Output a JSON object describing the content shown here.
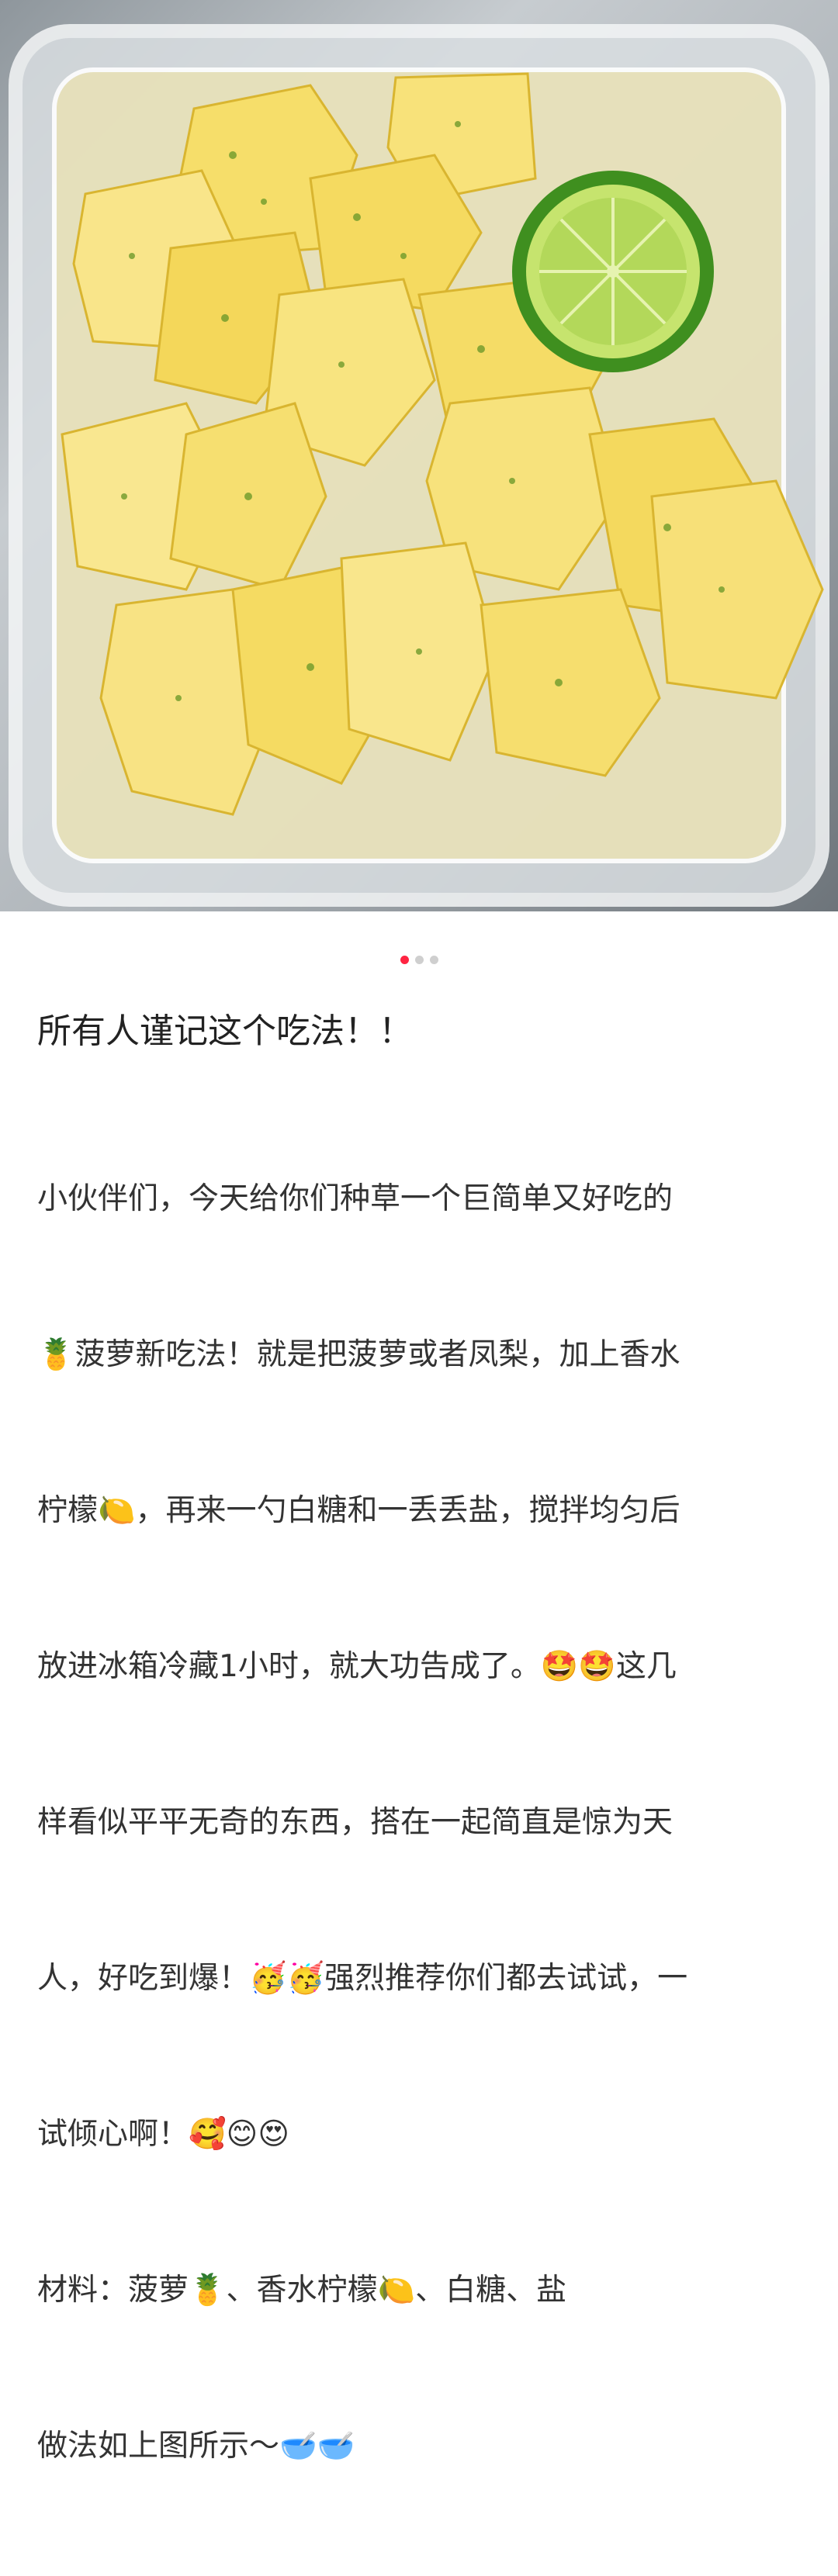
{
  "image": {
    "subject": "pineapple-icon",
    "garnish": "lime-slice-icon",
    "container": "plastic-box"
  },
  "carousel": {
    "total": 3,
    "active": 0,
    "active_color": "#ff2442",
    "inactive_color": "#cfcfcf"
  },
  "post": {
    "title": "所有人谨记这个吃法！！",
    "body_lines": [
      "小伙伴们，今天给你们种草一个巨简单又好吃的",
      "🍍菠萝新吃法！就是把菠萝或者凤梨，加上香水",
      "柠檬🍋，再来一勺白糖和一丢丢盐，搅拌均匀后",
      "放进冰箱冷藏1小时，就大功告成了。🤩🤩这几",
      "样看似平平无奇的东西，搭在一起简直是惊为天",
      "人，好吃到爆！🥳🥳强烈推荐你们都去试试，一",
      "试倾心啊！🥰😊😍",
      "材料：菠萝🍍、香水柠檬🍋、白糖、盐",
      "做法如上图所示～🥣🥣"
    ]
  }
}
